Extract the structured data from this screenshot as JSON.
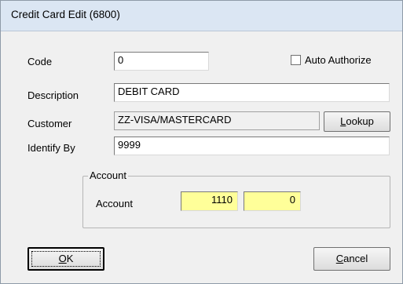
{
  "window": {
    "title": "Credit Card Edit (6800)"
  },
  "form": {
    "code_label": "Code",
    "code_value": "0",
    "auto_authorize_label": "Auto Authorize",
    "auto_authorize_checked": false,
    "description_label": "Description",
    "description_value": "DEBIT CARD",
    "customer_label": "Customer",
    "customer_value": "ZZ-VISA/MASTERCARD",
    "lookup_label": "Lookup",
    "identify_by_label": "Identify By",
    "identify_by_value": "9999"
  },
  "account_group": {
    "title": "Account",
    "account_label": "Account",
    "account_value_1": "1110",
    "account_value_2": "0",
    "highlight_color": "#ffff99"
  },
  "buttons": {
    "ok_label": "OK",
    "cancel_label": "Cancel"
  }
}
